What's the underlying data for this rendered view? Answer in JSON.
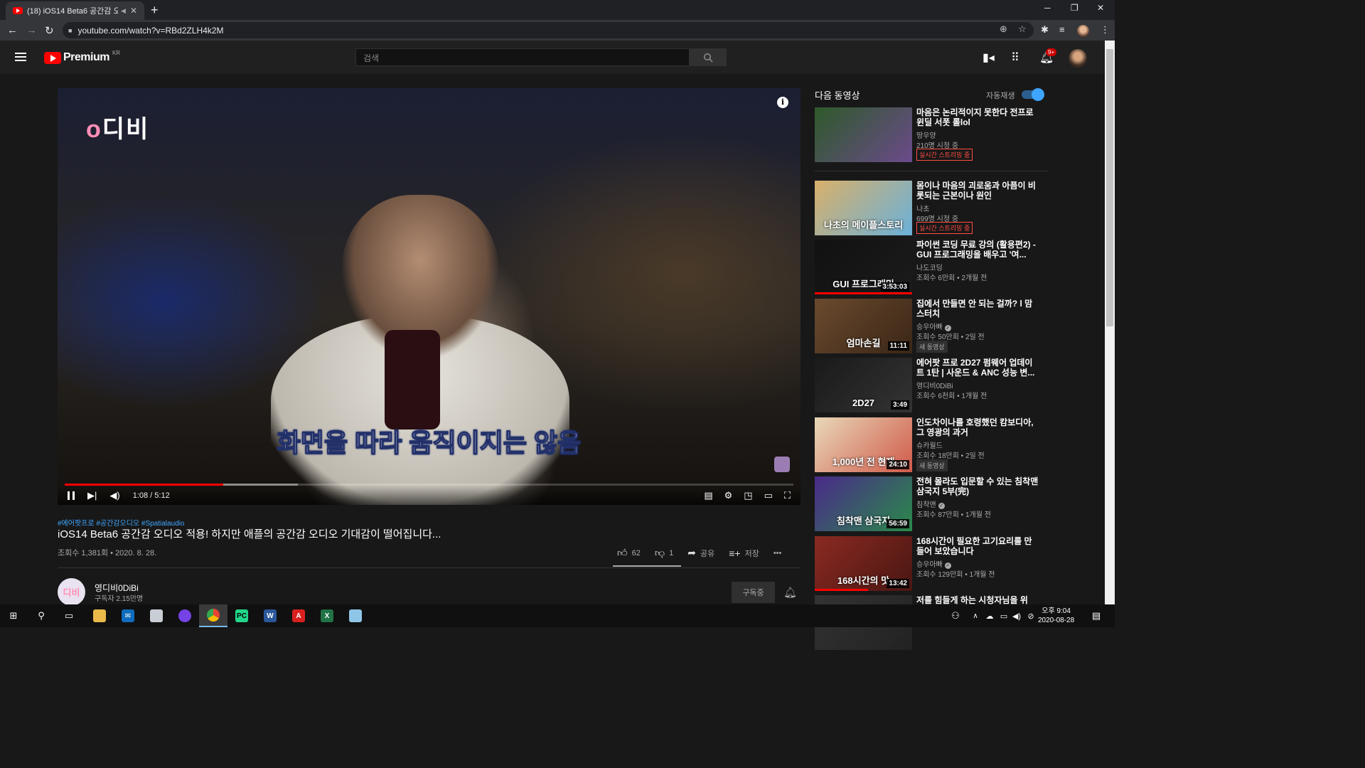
{
  "browser": {
    "tab_title": "(18) iOS14 Beta6 공간감 오디",
    "tab_close": "✕",
    "new_tab": "+",
    "url": "youtube.com/watch?v=RBd2ZLH4k2M",
    "win_minimize": "─",
    "win_restore": "❐",
    "win_close": "✕"
  },
  "youtube_header": {
    "brand": "Premium",
    "region": "KR",
    "search_placeholder": "검색",
    "notifications_badge": "9+"
  },
  "player": {
    "channel_watermark": "디비",
    "subtitle": "화면을 따라 움직이지는 않음",
    "current_time": "1:08",
    "duration": "5:12",
    "time_separator": " / ",
    "played_fraction": 0.218,
    "buffered_fraction": 0.32
  },
  "video": {
    "hashtags": "#에어팟프로 #공간감오디오 #Spatialaudio",
    "title": "iOS14 Beta6 공간감 오디오 적용! 하지만 애플의 공간감 오디오 기대감이 떨어집니다...",
    "views_date": "조회수 1,381회 • 2020. 8. 28.",
    "likes": "62",
    "dislikes": "1",
    "share_label": "공유",
    "save_label": "저장",
    "more_label": "•••",
    "like_ratio": 0.98
  },
  "channel": {
    "avatar_text": "디비",
    "name": "영디비0DiBi",
    "subscribers": "구독자 2.15만명",
    "subscribed_label": "구독중"
  },
  "sidebar": {
    "up_next_label": "다음 동영상",
    "autoplay_label": "자동재생",
    "autoplay_on": true,
    "items": [
      {
        "title": "마음은 논리적이지 못한다 전프로윈딜 서폿 롤lol",
        "channel": "땅우양",
        "views": "210명 시청 중",
        "live": "실시간 스트리밍 중",
        "thumb_colors": [
          "#2e5a2a",
          "#6b4a8a"
        ]
      },
      {
        "title": "몸이나 마음의 괴로움과 아픔이 비롯되는 근본이나 원인",
        "channel": "나초",
        "views": "699명 시청 중",
        "live": "실시간 스트리밍 중",
        "thumb_label": "나초의 메이플스토리",
        "thumb_colors": [
          "#d9b06a",
          "#6ab0d9"
        ]
      },
      {
        "title": "파이썬 코딩 무료 강의 (활용편2) - GUI 프로그래밍을 배우고 '여...",
        "channel": "나도코딩",
        "views": "조회수 6만회 • 2개월 전",
        "thumb_label": "GUI 프로그래밍",
        "duration": "3:53:03",
        "watched_fraction": 1.0,
        "thumb_colors": [
          "#111111",
          "#1b1b1b"
        ]
      },
      {
        "title": "집에서 만들면 안 되는 걸까? l 맘스터치",
        "channel": "승우아빠",
        "verified": true,
        "views": "조회수 50만회 • 2일 전",
        "badge": "새 동영상",
        "thumb_label": "엄마손길",
        "duration": "11:11",
        "thumb_colors": [
          "#6a4a2e",
          "#3a2616"
        ]
      },
      {
        "title": "에어팟 프로 2D27 펌웨어 업데이트 1탄 | 사운드 & ANC 성능 변...",
        "channel": "영디비0DiBi",
        "views": "조회수 6천회 • 1개월 전",
        "thumb_label": "2D27",
        "duration": "3:49",
        "thumb_colors": [
          "#1a1a1a",
          "#333333"
        ]
      },
      {
        "title": "인도차이나를 호령했던 캄보디아, 그 영광의 과거",
        "channel": "슈카월드",
        "views": "조회수 18만회 • 2일 전",
        "badge": "새 동영상",
        "thumb_label": "1,000년 전   현재",
        "duration": "24:10",
        "thumb_colors": [
          "#e8d8b8",
          "#d05a4a"
        ]
      },
      {
        "title": "전혀 몰라도 입문할 수 있는 침착맨 삼국지 5부(完)",
        "channel": "침착맨",
        "verified": true,
        "views": "조회수 87만회 • 1개월 전",
        "thumb_label": "침착맨 삼국지",
        "duration": "56:59",
        "thumb_colors": [
          "#4a2a8a",
          "#2a8a4a"
        ]
      },
      {
        "title": "168시간이 필요한 고기요리를 만들어 보았습니다",
        "channel": "승우아빠",
        "verified": true,
        "views": "조회수 129만회 • 1개월 전",
        "thumb_label": "168시간의 맛",
        "duration": "13:42",
        "watched_fraction": 0.55,
        "thumb_colors": [
          "#8a2a22",
          "#4a1612"
        ]
      },
      {
        "title": "저를 힘들게 하는 시청자님을 위",
        "channel": "",
        "views": "",
        "thumb_colors": [
          "#333333",
          "#222222"
        ]
      }
    ]
  },
  "taskbar": {
    "time": "오후 9:04",
    "date": "2020-08-28",
    "apps": [
      "file-explorer",
      "mail",
      "paint",
      "firefox",
      "chrome",
      "pycharm",
      "word",
      "acrobat",
      "excel",
      "notepad"
    ]
  }
}
